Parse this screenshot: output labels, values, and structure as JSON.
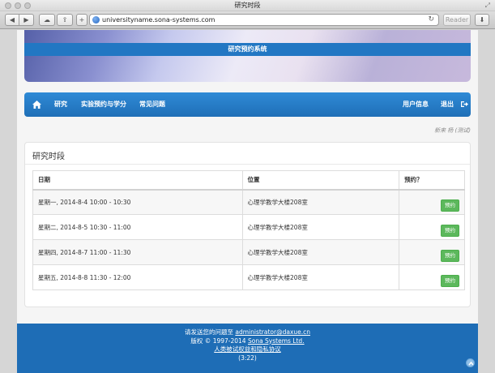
{
  "window": {
    "title": "研究时段"
  },
  "browser": {
    "url": "universityname.sona-systems.com",
    "reader_label": "Reader"
  },
  "banner": {
    "system_title": "研究预约系统"
  },
  "nav": {
    "items": [
      "研究",
      "实验预约与学分",
      "常见问题"
    ],
    "user_info": "用户信息",
    "logout": "退出"
  },
  "user_line": "新来 杨 (测试)",
  "card": {
    "title": "研究时段",
    "columns": [
      "日期",
      "位置",
      "预约？"
    ],
    "rows": [
      {
        "date": "星期一, 2014-8-4 10:00 - 10:30",
        "location": "心理学教学大楼208室",
        "action": "预约"
      },
      {
        "date": "星期二, 2014-8-5 10:30 - 11:00",
        "location": "心理学教学大楼208室",
        "action": "预约"
      },
      {
        "date": "星期四, 2014-8-7 11:00 - 11:30",
        "location": "心理学教学大楼208室",
        "action": "预约"
      },
      {
        "date": "星期五, 2014-8-8 11:30 - 12:00",
        "location": "心理学教学大楼208室",
        "action": "预约"
      }
    ]
  },
  "footer": {
    "contact_prefix": "请发送您的问题至",
    "contact_email": "administrator@daxue.cn",
    "copyright_prefix": "版权 © 1997-2014",
    "copyright_company": "Sona Systems Ltd.",
    "privacy": "人类被试权益和隐私协议",
    "time": "(3:22)"
  },
  "colors": {
    "nav_blue": "#1f6fb7",
    "book_green": "#5cb85c",
    "footer_blue": "#1e6db6"
  }
}
